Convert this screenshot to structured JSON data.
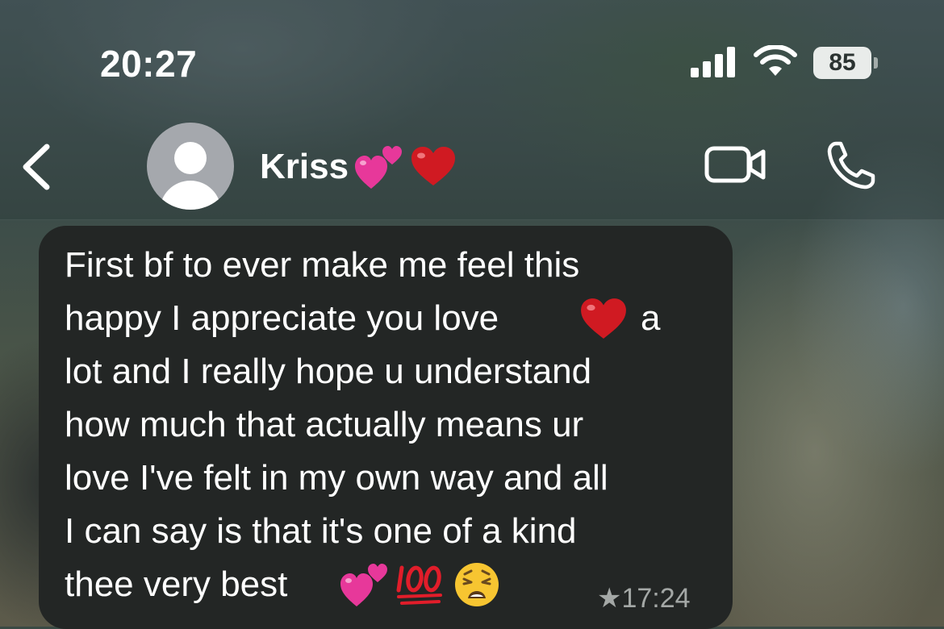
{
  "status_bar": {
    "time": "20:27",
    "battery": "85",
    "icons": [
      "cellular-signal-icon",
      "wifi-icon",
      "battery-icon"
    ]
  },
  "header": {
    "back_icon": "chevron-left-icon",
    "contact_name": "Kriss",
    "name_emojis": [
      "two-hearts-icon",
      "red-heart-icon"
    ],
    "actions": [
      "video-camera-icon",
      "phone-icon"
    ]
  },
  "message": {
    "lines": [
      "First bf to ever make me feel this",
      "happy I appreciate you love",
      "a",
      "lot and I really hope u understand",
      "how much that actually means ur",
      "love I've felt in my own way and all",
      "I can say is that it's one of a kind",
      "thee very best"
    ],
    "inline_emojis": [
      "red-heart-icon",
      "two-hearts-icon",
      "hundred-points-icon",
      "weary-face-icon"
    ],
    "starred_icon": "star-icon",
    "star_glyph": "★",
    "time": "17:24"
  },
  "colors": {
    "bubble": "#232625",
    "meta_text": "#a4a8a6",
    "heart_red": "#d01a22",
    "heart_pink": "#e7389a"
  }
}
